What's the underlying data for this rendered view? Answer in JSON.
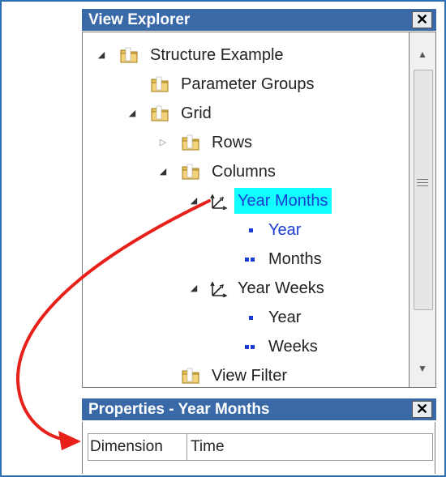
{
  "view_explorer": {
    "title": "View Explorer",
    "close_glyph": "✕",
    "tree": [
      {
        "label": "Structure Example",
        "icon": "folder-icon",
        "toggle": "expanded"
      },
      {
        "label": "Parameter Groups",
        "icon": "folder-icon",
        "toggle": "none"
      },
      {
        "label": "Grid",
        "icon": "folder-icon",
        "toggle": "expanded"
      },
      {
        "label": "Rows",
        "icon": "folder-icon",
        "toggle": "collapsed"
      },
      {
        "label": "Columns",
        "icon": "folder-icon",
        "toggle": "expanded"
      },
      {
        "label": "Year Months",
        "icon": "dimension-icon",
        "toggle": "expanded",
        "selected": true
      },
      {
        "label": "Year",
        "icon": "level-icon-single",
        "toggle": "none"
      },
      {
        "label": "Months",
        "icon": "level-icon-double",
        "toggle": "none"
      },
      {
        "label": "Year Weeks",
        "icon": "dimension-icon",
        "toggle": "expanded"
      },
      {
        "label": "Year",
        "icon": "level-icon-single",
        "toggle": "none"
      },
      {
        "label": "Weeks",
        "icon": "level-icon-double",
        "toggle": "none"
      },
      {
        "label": "View Filter",
        "icon": "folder-icon",
        "toggle": "none"
      }
    ]
  },
  "properties": {
    "title": "Properties - Year Months",
    "close_glyph": "✕",
    "rows": [
      {
        "name": "Dimension",
        "value": "Time"
      }
    ]
  },
  "colors": {
    "header_bg": "#3a69a8",
    "selection_bg": "#12ffff",
    "annotation_arrow": "#e8201a"
  }
}
